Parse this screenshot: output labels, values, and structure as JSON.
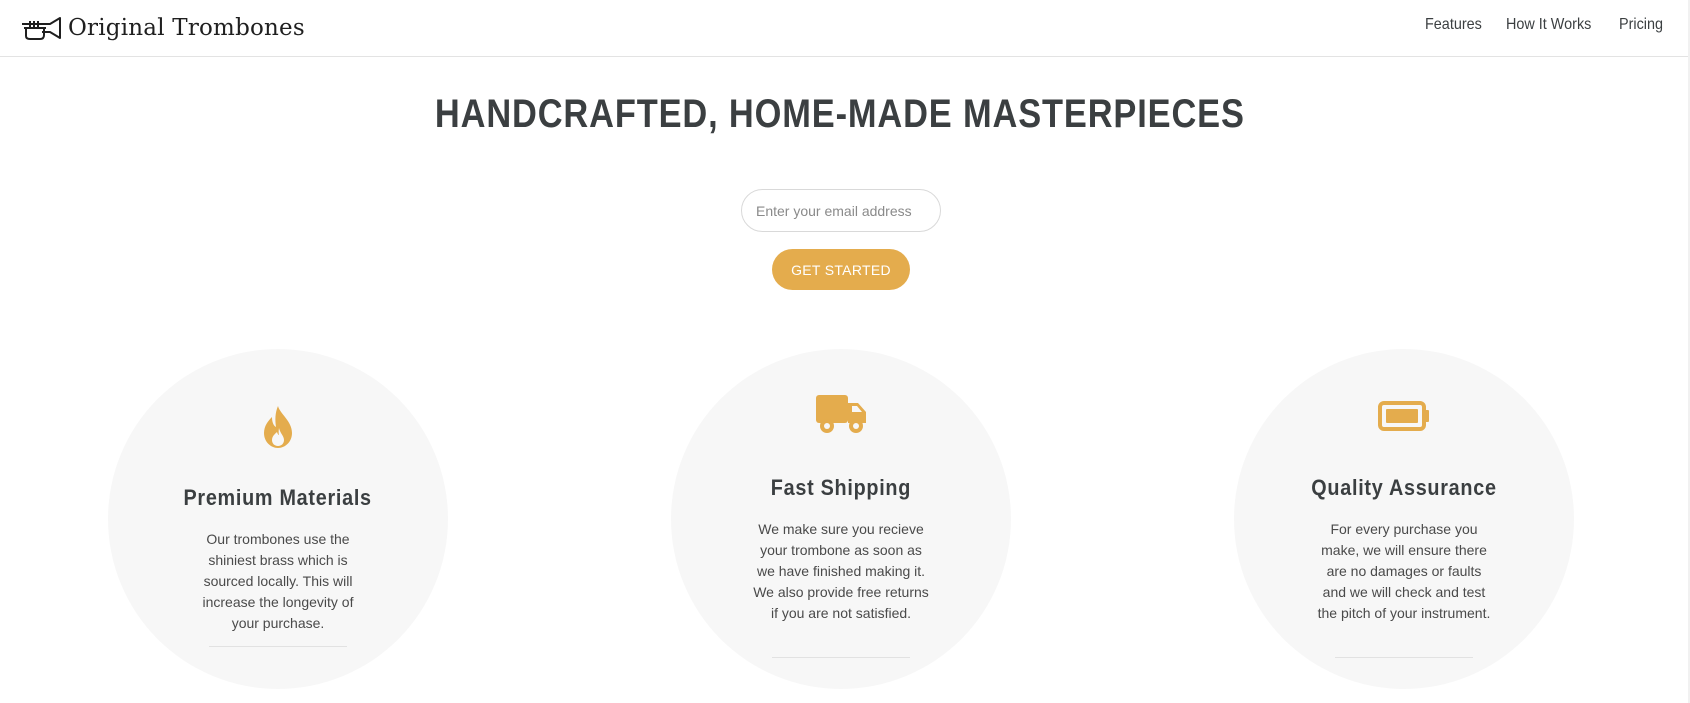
{
  "header": {
    "brand": "Original Trombones",
    "logo_icon": "trumpet-icon",
    "nav": [
      "Features",
      "How It Works",
      "Pricing"
    ]
  },
  "hero": {
    "title": "HANDCRAFTED, HOME-MADE MASTERPIECES",
    "email_placeholder": "Enter your email address",
    "cta_label": "GET STARTED"
  },
  "accent_color": "#e4ac4d",
  "features": [
    {
      "icon": "fire-icon",
      "title": "Premium Materials",
      "desc": "Our trombones use the shiniest brass which is sourced locally. This will increase the longevity of your purchase."
    },
    {
      "icon": "truck-icon",
      "title": "Fast Shipping",
      "desc": "We make sure you recieve your trombone as soon as we have finished making it. We also provide free returns if you are not satisfied."
    },
    {
      "icon": "battery-icon",
      "title": "Quality Assurance",
      "desc": "For every purchase you make, we will ensure there are no damages or faults and we will check and test the pitch of your instrument."
    }
  ]
}
